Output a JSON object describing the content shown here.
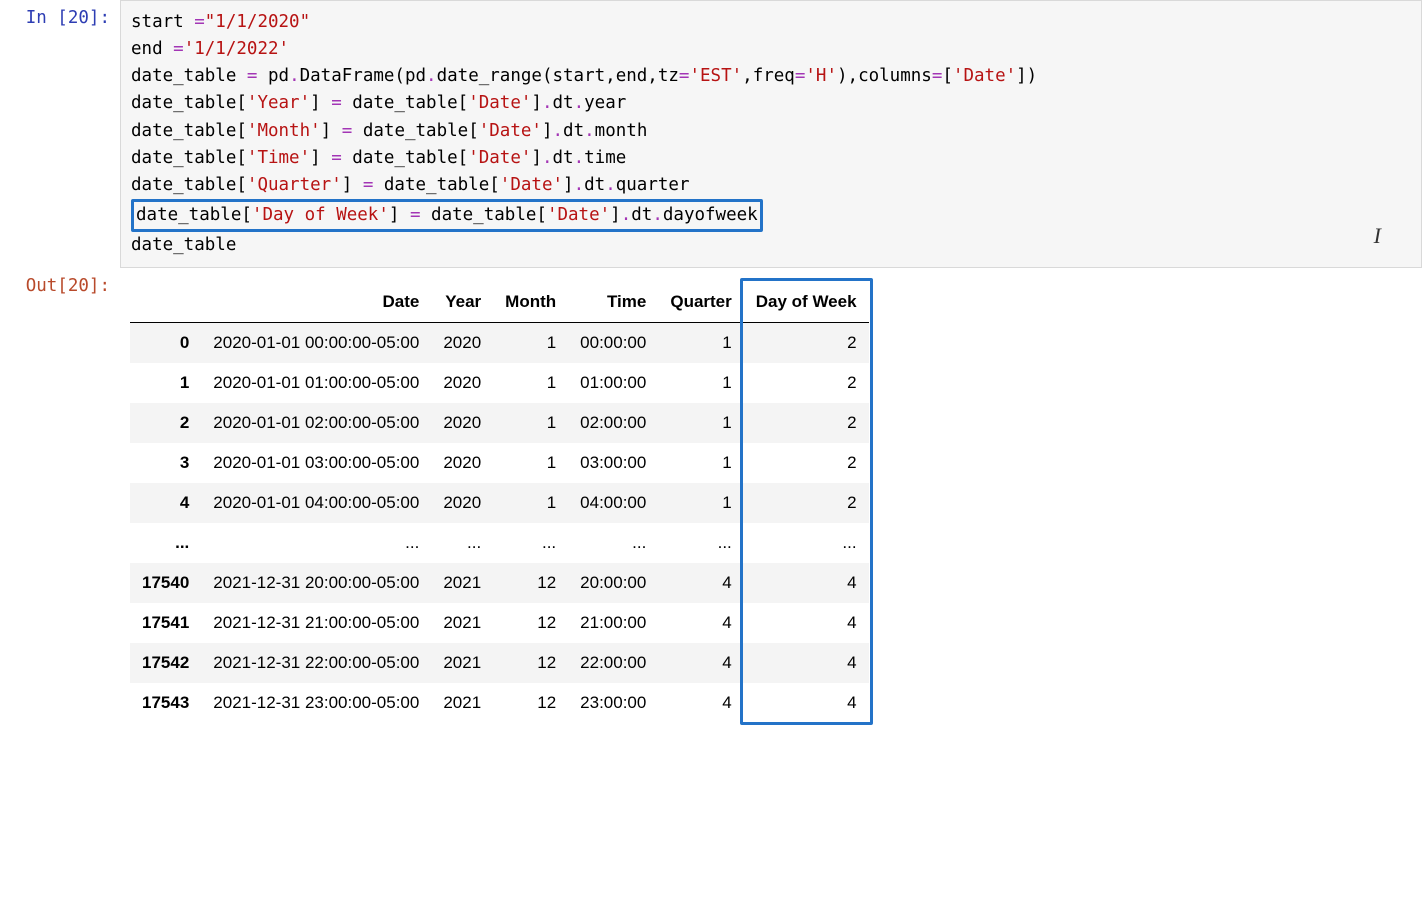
{
  "input_prompt": "In [20]:",
  "output_prompt": "Out[20]:",
  "code": {
    "l1": {
      "a": "start ",
      "op": "=",
      "b": "\"1/1/2020\""
    },
    "l2": {
      "a": "end ",
      "op": "=",
      "b": "'1/1/2022'"
    },
    "l3": {
      "a": "date_table ",
      "op1": "=",
      "b": " pd",
      "dot1": ".",
      "c": "DataFrame(pd",
      "dot2": ".",
      "d": "date_range(start,end,tz",
      "op2": "=",
      "s1": "'EST'",
      "e": ",freq",
      "op3": "=",
      "s2": "'H'",
      "f": "),columns",
      "op4": "=",
      "g": "[",
      "s3": "'Date'",
      "h": "])"
    },
    "l4": {
      "a": "date_table[",
      "s1": "'Year'",
      "b": "] ",
      "op": "=",
      "c": " date_table[",
      "s2": "'Date'",
      "d": "]",
      "dot": ".",
      "e": "dt",
      "dot2": ".",
      "f": "year"
    },
    "l5": {
      "a": "date_table[",
      "s1": "'Month'",
      "b": "] ",
      "op": "=",
      "c": " date_table[",
      "s2": "'Date'",
      "d": "]",
      "dot": ".",
      "e": "dt",
      "dot2": ".",
      "f": "month"
    },
    "l6": {
      "a": "date_table[",
      "s1": "'Time'",
      "b": "] ",
      "op": "=",
      "c": " date_table[",
      "s2": "'Date'",
      "d": "]",
      "dot": ".",
      "e": "dt",
      "dot2": ".",
      "f": "time"
    },
    "l7": {
      "a": "date_table[",
      "s1": "'Quarter'",
      "b": "] ",
      "op": "=",
      "c": " date_table[",
      "s2": "'Date'",
      "d": "]",
      "dot": ".",
      "e": "dt",
      "dot2": ".",
      "f": "quarter"
    },
    "l8": {
      "a": "date_table[",
      "s1": "'Day of Week'",
      "b": "] ",
      "op": "=",
      "c": " date_table[",
      "s2": "'Date'",
      "d": "]",
      "dot": ".",
      "e": "dt",
      "dot2": ".",
      "f": "dayofweek"
    },
    "l9": "date_table"
  },
  "table": {
    "columns": [
      "",
      "Date",
      "Year",
      "Month",
      "Time",
      "Quarter",
      "Day of Week"
    ],
    "rows": [
      {
        "idx": "0",
        "date": "2020-01-01 00:00:00-05:00",
        "year": "2020",
        "month": "1",
        "time": "00:00:00",
        "quarter": "1",
        "dow": "2"
      },
      {
        "idx": "1",
        "date": "2020-01-01 01:00:00-05:00",
        "year": "2020",
        "month": "1",
        "time": "01:00:00",
        "quarter": "1",
        "dow": "2"
      },
      {
        "idx": "2",
        "date": "2020-01-01 02:00:00-05:00",
        "year": "2020",
        "month": "1",
        "time": "02:00:00",
        "quarter": "1",
        "dow": "2"
      },
      {
        "idx": "3",
        "date": "2020-01-01 03:00:00-05:00",
        "year": "2020",
        "month": "1",
        "time": "03:00:00",
        "quarter": "1",
        "dow": "2"
      },
      {
        "idx": "4",
        "date": "2020-01-01 04:00:00-05:00",
        "year": "2020",
        "month": "1",
        "time": "04:00:00",
        "quarter": "1",
        "dow": "2"
      },
      {
        "idx": "...",
        "date": "...",
        "year": "...",
        "month": "...",
        "time": "...",
        "quarter": "...",
        "dow": "..."
      },
      {
        "idx": "17540",
        "date": "2021-12-31 20:00:00-05:00",
        "year": "2021",
        "month": "12",
        "time": "20:00:00",
        "quarter": "4",
        "dow": "4"
      },
      {
        "idx": "17541",
        "date": "2021-12-31 21:00:00-05:00",
        "year": "2021",
        "month": "12",
        "time": "21:00:00",
        "quarter": "4",
        "dow": "4"
      },
      {
        "idx": "17542",
        "date": "2021-12-31 22:00:00-05:00",
        "year": "2021",
        "month": "12",
        "time": "22:00:00",
        "quarter": "4",
        "dow": "4"
      },
      {
        "idx": "17543",
        "date": "2021-12-31 23:00:00-05:00",
        "year": "2021",
        "month": "12",
        "time": "23:00:00",
        "quarter": "4",
        "dow": "4"
      }
    ]
  }
}
